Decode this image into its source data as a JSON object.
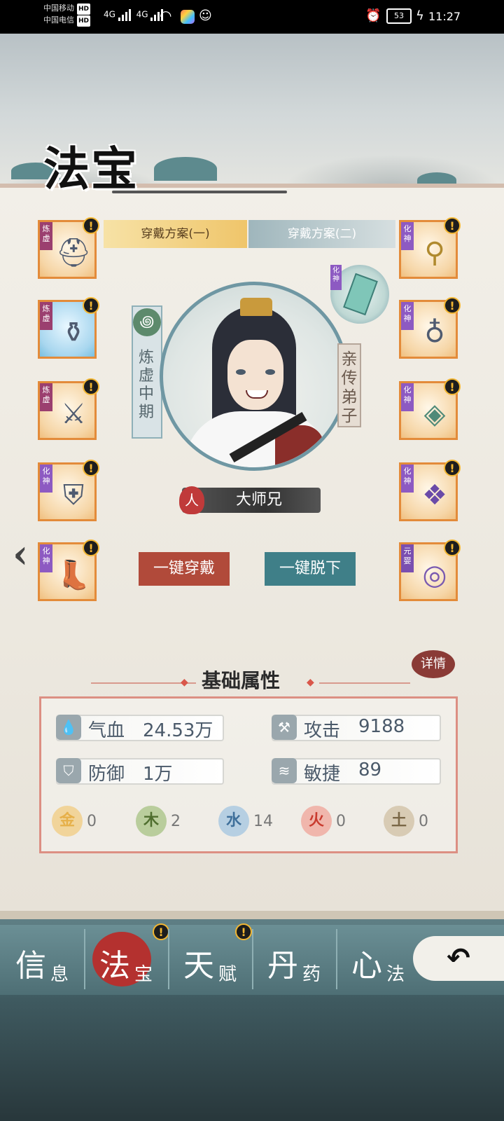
{
  "status_bar": {
    "carrier1": "中国移动",
    "carrier2": "中国电信",
    "hd": "HD",
    "net1": "4G",
    "net2": "4G",
    "battery": "53",
    "time": "11:27"
  },
  "page": {
    "title": "法宝"
  },
  "plans": {
    "tab1": "穿戴方案(一)",
    "tab2": "穿戴方案(二)"
  },
  "character": {
    "realm": "炼虚中期",
    "title": "亲传弟子",
    "race": "人",
    "name": "大师兄",
    "talisman_tier": "化神"
  },
  "slots_left": [
    {
      "tier": "炼虚",
      "icon": "helmet-icon",
      "badge": "!"
    },
    {
      "tier": "炼虚",
      "icon": "cauldron-icon",
      "badge": "!"
    },
    {
      "tier": "炼虚",
      "icon": "sword-icon",
      "badge": "!"
    },
    {
      "tier": "化神",
      "icon": "armor-icon",
      "badge": "!"
    },
    {
      "tier": "化神",
      "icon": "boots-icon",
      "badge": "!"
    }
  ],
  "slots_right": [
    {
      "tier": "化神",
      "icon": "hairpin-icon",
      "badge": "!"
    },
    {
      "tier": "化神",
      "icon": "necklace-icon",
      "badge": "!"
    },
    {
      "tier": "化神",
      "icon": "jade-icon",
      "badge": "!"
    },
    {
      "tier": "化神",
      "icon": "belt-icon",
      "badge": "!"
    },
    {
      "tier": "元婴",
      "icon": "ring-icon",
      "badge": "!"
    }
  ],
  "actions": {
    "equip_all": "一键穿戴",
    "unequip_all": "一键脱下"
  },
  "stats": {
    "title": "基础属性",
    "detail": "详情",
    "hp_label": "气血",
    "hp_value": "24.53万",
    "atk_label": "攻击",
    "atk_value": "9188",
    "def_label": "防御",
    "def_value": "1万",
    "agi_label": "敏捷",
    "agi_value": "89",
    "elements": [
      {
        "glyph": "金",
        "value": "0",
        "color": "#e6b04a"
      },
      {
        "glyph": "木",
        "value": "2",
        "color": "#7a9a52"
      },
      {
        "glyph": "水",
        "value": "14",
        "color": "#6e9cc2"
      },
      {
        "glyph": "火",
        "value": "0",
        "color": "#d9574a"
      },
      {
        "glyph": "土",
        "value": "0",
        "color": "#9c8a6a"
      }
    ]
  },
  "nav": [
    {
      "big": "信",
      "small": "息"
    },
    {
      "big": "法",
      "small": "宝"
    },
    {
      "big": "天",
      "small": "赋"
    },
    {
      "big": "丹",
      "small": "药"
    },
    {
      "big": "心",
      "small": "法"
    }
  ],
  "nav_badge": "!",
  "back_glyph": "↶"
}
